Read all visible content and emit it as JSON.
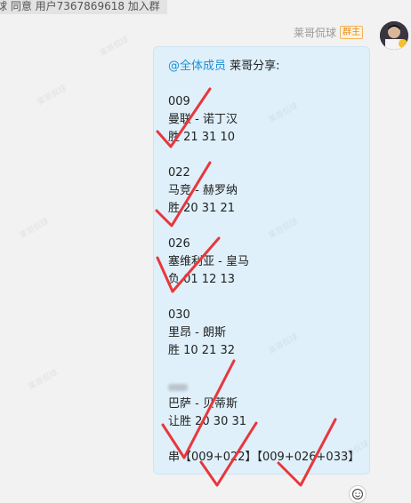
{
  "system_notice": "球 同意 用户7367869618 加入群",
  "sender": {
    "name": "莱哥侃球",
    "badge": "群主"
  },
  "message": {
    "mention": "@全体成员",
    "intro": " 莱哥分享:",
    "matches": [
      {
        "code": "009",
        "teams": "曼联 - 诺丁汉",
        "pick": "胜 21 31 10"
      },
      {
        "code": "022",
        "teams": "马竞 - 赫罗纳",
        "pick": "胜 20 31 21"
      },
      {
        "code": "026",
        "teams": "塞维利亚 - 皇马",
        "pick": "负 01 12 13"
      },
      {
        "code": "030",
        "teams": "里昂 - 朗斯",
        "pick": "胜 10 21 32"
      },
      {
        "code": "",
        "teams": "巴萨 - 贝蒂斯",
        "pick": "让胜 20 30 31"
      }
    ],
    "parlay": "串【009+022】【009+026+033】"
  },
  "watermark_text": "莱哥侃球",
  "colors": {
    "bubble": "#dff0fa",
    "mention": "#1f8fd8",
    "check": "#e8373c"
  },
  "icons": {
    "reaction": "smiley-add-icon"
  }
}
